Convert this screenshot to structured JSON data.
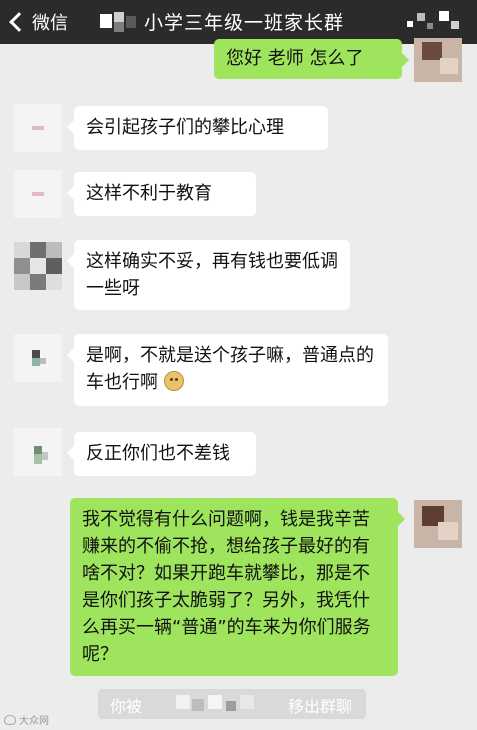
{
  "header": {
    "back_label": "微信",
    "title": "小学三年级一班家长群"
  },
  "messages": [
    {
      "side": "right",
      "text": "您好 老师 怎么了"
    },
    {
      "side": "left",
      "text": "会引起孩子们的攀比心理"
    },
    {
      "side": "left",
      "text": "这样不利于教育"
    },
    {
      "side": "left",
      "text": "这样确实不妥，再有钱也要低调一些呀"
    },
    {
      "side": "left",
      "text": "是啊，不就是送个孩子嘛，普通点的车也行啊"
    },
    {
      "side": "left",
      "text": "反正你们也不差钱"
    },
    {
      "side": "right",
      "text": "我不觉得有什么问题啊，钱是我辛苦赚来的不偷不抢，想给孩子最好的有啥不对？如果开跑车就攀比，那是不是你们孩子太脆弱了？另外，我凭什么再买一辆“普通”的车来为你们服务呢？"
    }
  ],
  "system_notice": {
    "prefix": "你被",
    "suffix": "移出群聊"
  },
  "icons": {
    "back": "chevron-left-icon",
    "emoji": "emoji-icon"
  },
  "colors": {
    "header_bg": "#2b2b2b",
    "chat_bg": "#ececec",
    "sent_bubble": "#9fe45d",
    "received_bubble": "#ffffff"
  },
  "watermark": "大众网"
}
